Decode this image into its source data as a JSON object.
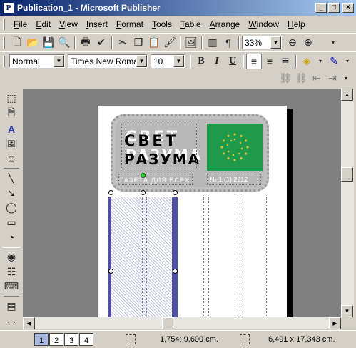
{
  "window": {
    "title": "Publication_1 - Microsoft Publisher",
    "app_icon": "publisher-icon"
  },
  "menu": [
    "File",
    "Edit",
    "View",
    "Insert",
    "Format",
    "Tools",
    "Table",
    "Arrange",
    "Window",
    "Help"
  ],
  "standard_toolbar": {
    "zoom": "33%"
  },
  "format_toolbar": {
    "style": "Normal",
    "font": "Times New Roman",
    "size": "10"
  },
  "document": {
    "masthead_title_line1": "СВЕТ",
    "masthead_title_line2": "РАЗУМА",
    "masthead_subtitle": "ГАЗЕТА ДЛЯ ВСЕХ",
    "masthead_issue": "№ 1 (1)   2012"
  },
  "status": {
    "pages": [
      "1",
      "2",
      "3",
      "4"
    ],
    "current_page": "1",
    "position": "1,754; 9,600 cm.",
    "size": "6,491 x 17,343 cm."
  },
  "colors": {
    "flag_green": "#1f9a4a",
    "title_bar": "#0a246a",
    "selection": "#5050a0"
  }
}
